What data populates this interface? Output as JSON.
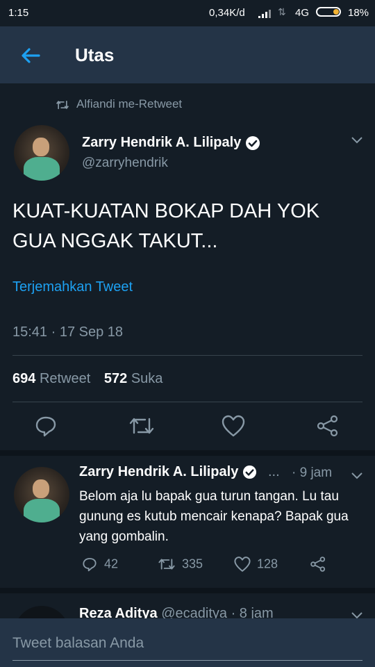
{
  "status_bar": {
    "time": "1:15",
    "network_speed": "0,34K/d",
    "network_type": "4G",
    "battery": "18%"
  },
  "header": {
    "title": "Utas",
    "back_icon": "arrow-left-icon"
  },
  "retweet_notice": {
    "icon": "retweet-icon",
    "text": "Alfiandi me-Retweet"
  },
  "tweet": {
    "author_name": "Zarry Hendrik A. Lilipaly",
    "handle": "@zarryhendrik",
    "verified": true,
    "text_line1": "KUAT-KUATAN BOKAP DAH YOK",
    "text_line2": "GUA NGGAK TAKUT...",
    "translate_label": "Terjemahkan Tweet",
    "timestamp": "15:41 · 17 Sep 18",
    "retweet_count": "694",
    "retweet_label": "Retweet",
    "like_count": "572",
    "like_label": "Suka"
  },
  "reply": {
    "author_name": "Zarry Hendrik A. Lilipaly",
    "ellipsis": "...",
    "time": "· 9 jam",
    "text": "Belom aja lu bapak gua turun tangan. Lu tau gunung es kutub mencair kenapa? Bapak gua yang gombalin.",
    "reply_count": "42",
    "retweet_count": "335",
    "like_count": "128"
  },
  "next_reply": {
    "author_name": "Reza Aditya",
    "handle": "@ecaditya",
    "time": "· 8 jam"
  },
  "composer": {
    "placeholder": "Tweet balasan Anda"
  },
  "colors": {
    "background": "#141d26",
    "bar": "#243447",
    "accent": "#1da1f2",
    "secondary_text": "#8899a6",
    "divider": "#38444d"
  }
}
